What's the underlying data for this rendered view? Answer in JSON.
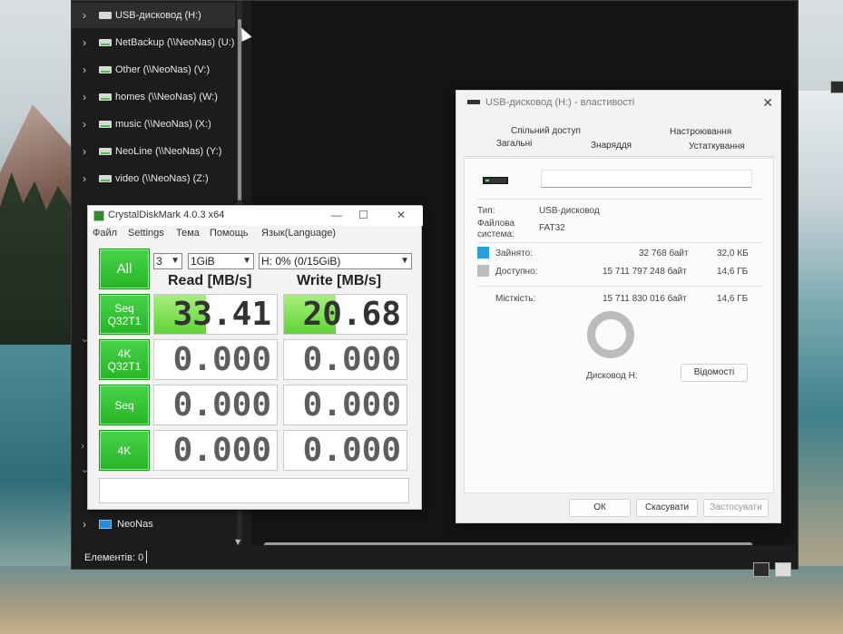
{
  "explorer": {
    "nav_items": [
      {
        "label": "USB-дисковод (H:)",
        "type": "drive"
      },
      {
        "label": "NetBackup (\\\\NeoNas) (U:)",
        "type": "net"
      },
      {
        "label": "Other (\\\\NeoNas) (V:)",
        "type": "net"
      },
      {
        "label": "homes (\\\\NeoNas) (W:)",
        "type": "net"
      },
      {
        "label": "music (\\\\NeoNas) (X:)",
        "type": "net"
      },
      {
        "label": "NeoLine (\\\\NeoNas) (Y:)",
        "type": "net"
      },
      {
        "label": "video (\\\\NeoNas) (Z:)",
        "type": "net"
      }
    ],
    "network_item": "NeoNas",
    "status": "Елементів: 0"
  },
  "cdm": {
    "title": "CrystalDiskMark 4.0.3 x64",
    "menu": [
      "Файл",
      "Settings",
      "Тема",
      "Помощь",
      "Язык(Language)"
    ],
    "all_button": "All",
    "count_select": "3",
    "size_select": "1GiB",
    "drive_select": "H: 0% (0/15GiB)",
    "read_header": "Read [MB/s]",
    "write_header": "Write [MB/s]",
    "tests": [
      {
        "line1": "Seq",
        "line2": "Q32T1",
        "read": "33.41",
        "write": "20.68",
        "read_fill": 0.42,
        "write_fill": 0.42
      },
      {
        "line1": "4K",
        "line2": "Q32T1",
        "read": "0.000",
        "write": "0.000",
        "read_fill": 0,
        "write_fill": 0
      },
      {
        "line1": "Seq",
        "line2": "",
        "read": "0.000",
        "write": "0.000",
        "read_fill": 0,
        "write_fill": 0
      },
      {
        "line1": "4K",
        "line2": "",
        "read": "0.000",
        "write": "0.000",
        "read_fill": 0,
        "write_fill": 0
      }
    ]
  },
  "props": {
    "title": "USB-дисковод (H:) - властивості",
    "tabs_row1": [
      "Спільний доступ",
      "Настроювання"
    ],
    "tabs_row2": [
      "Загальні",
      "Знаряддя",
      "Устаткування"
    ],
    "type_label": "Тип:",
    "type_value": "USB-дисковод",
    "fs_label": "Файлова система:",
    "fs_value": "FAT32",
    "used_label": "Зайнято:",
    "used_bytes": "32 768 байт",
    "used_size": "32,0 КБ",
    "free_label": "Доступно:",
    "free_bytes": "15 711 797 248 байт",
    "free_size": "14,6 ГБ",
    "cap_label": "Місткість:",
    "cap_bytes": "15 711 830 016 байт",
    "cap_size": "14,6 ГБ",
    "drive_label": "Дисковод H:",
    "details_button": "Відомості",
    "ok": "ОК",
    "cancel": "Скасувати",
    "apply": "Застосувати",
    "used_color": "#26a0da",
    "free_color": "#bcbcbc"
  }
}
